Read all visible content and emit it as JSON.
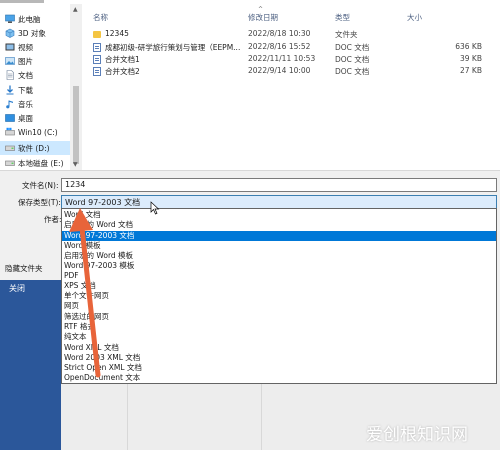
{
  "sidebar": {
    "items": [
      {
        "label": "此电脑",
        "icon": "computer-icon"
      },
      {
        "label": "3D 对象",
        "icon": "cube-3d-icon"
      },
      {
        "label": "视频",
        "icon": "video-icon"
      },
      {
        "label": "图片",
        "icon": "picture-icon"
      },
      {
        "label": "文档",
        "icon": "document-icon"
      },
      {
        "label": "下载",
        "icon": "download-icon"
      },
      {
        "label": "音乐",
        "icon": "music-icon"
      },
      {
        "label": "桌面",
        "icon": "desktop-icon"
      },
      {
        "label": "Win10 (C:)",
        "icon": "drive-icon"
      },
      {
        "label": "软件 (D:)",
        "icon": "drive-icon",
        "selected": true
      },
      {
        "label": "本地磁盘 (E:)",
        "icon": "drive-icon"
      }
    ]
  },
  "file_list": {
    "columns": {
      "name": "名称",
      "modified": "修改日期",
      "type": "类型",
      "size": "大小"
    },
    "rows": [
      {
        "name": "12345",
        "modified": "2022/8/18 10:30",
        "type": "文件夹",
        "size": "",
        "kind": "folder"
      },
      {
        "name": "成都初级-研学旅行策划与管理（EEPM...",
        "modified": "2022/8/16 15:52",
        "type": "DOC 文档",
        "size": "636 KB",
        "kind": "doc"
      },
      {
        "name": "合并文档1",
        "modified": "2022/11/11 10:53",
        "type": "DOC 文档",
        "size": "39 KB",
        "kind": "doc"
      },
      {
        "name": "合并文档2",
        "modified": "2022/9/14 10:00",
        "type": "DOC 文档",
        "size": "27 KB",
        "kind": "doc"
      }
    ]
  },
  "form": {
    "filename_label": "文件名(N):",
    "filename_value": "1234",
    "filetype_label": "保存类型(T):",
    "filetype_value": "Word 97-2003 文档",
    "author_label": "作者:",
    "hide_folders": "隐藏文件夹"
  },
  "dropdown": {
    "options": [
      "Word 文档",
      "启用宏的 Word 文档",
      "Word 97-2003 文档",
      "Word 模板",
      "启用宏的 Word 模板",
      "Word 97-2003 模板",
      "PDF",
      "XPS 文档",
      "单个文件网页",
      "网页",
      "筛选过的网页",
      "RTF 格式",
      "纯文本",
      "Word XML 文档",
      "Word 2003 XML 文档",
      "Strict Open XML 文档",
      "OpenDocument 文本"
    ],
    "highlighted": "Word 97-2003 文档"
  },
  "backstage": {
    "close_label": "关闭"
  },
  "watermark": "爱创根知识网",
  "colors": {
    "accent": "#0078d7",
    "word_blue": "#2b579a",
    "arrow": "#e8643a"
  }
}
